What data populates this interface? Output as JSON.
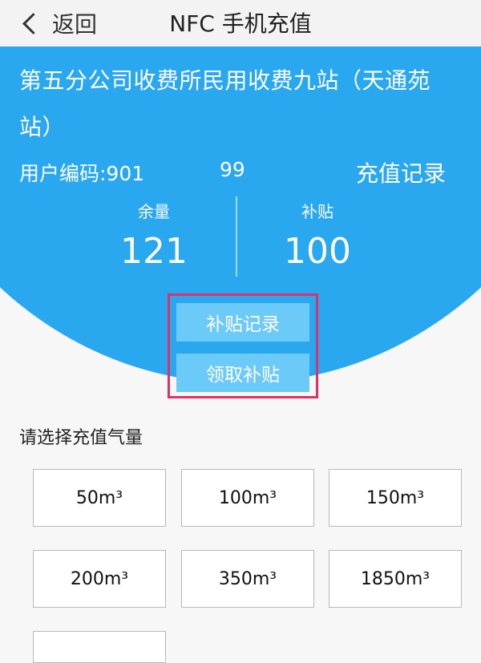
{
  "header": {
    "back_label": "返回",
    "title": "NFC 手机充值"
  },
  "account": {
    "station_name": "第五分公司收费所民用收费九站（天通苑站）",
    "user_code_label": "用户编码:901",
    "user_code_tail": "99",
    "recharge_record_label": "充值记录",
    "balance_label": "余量",
    "balance_value": "121",
    "subsidy_label": "补贴",
    "subsidy_value": "100"
  },
  "actions": {
    "subsidy_record_label": "补贴记录",
    "claim_subsidy_label": "领取补贴"
  },
  "recharge": {
    "prompt": "请选择充值气量",
    "options": [
      "50m³",
      "100m³",
      "150m³",
      "200m³",
      "350m³",
      "1850m³"
    ]
  },
  "colors": {
    "primary_blue": "#2aa8ef",
    "button_blue": "#6ccaf8",
    "highlight_border": "#e0306a"
  }
}
